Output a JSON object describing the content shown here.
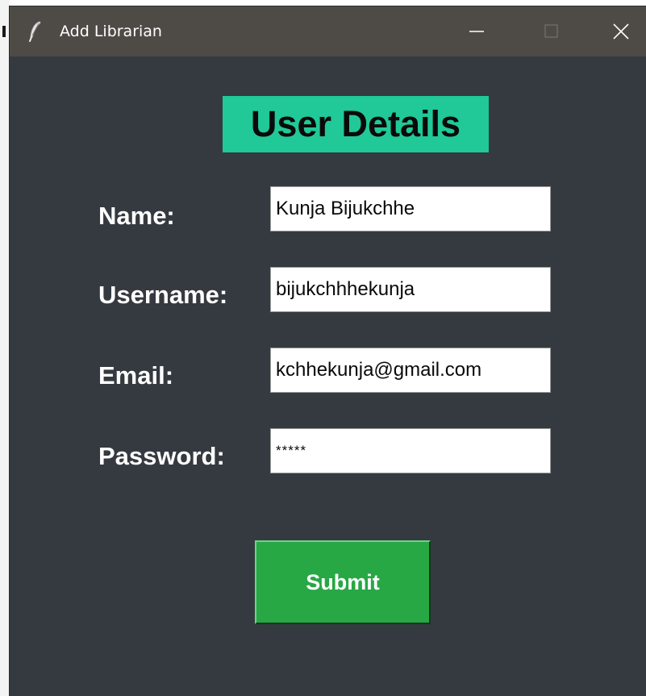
{
  "window": {
    "title": "Add Librarian"
  },
  "heading": "User Details",
  "fields": [
    {
      "label": "Name:",
      "value": "Kunja Bijukchhe"
    },
    {
      "label": "Username:",
      "value": "bijukchhhekunja"
    },
    {
      "label": "Email:",
      "value": "kchhekunja@gmail.com"
    },
    {
      "label": "Password:",
      "value": "*****"
    }
  ],
  "submit_label": "Submit",
  "colors": {
    "background": "#353a40",
    "titlebar": "#4e4b47",
    "heading_bg": "#20c997",
    "submit_bg": "#28a745"
  },
  "icons": {
    "app": "feather-icon",
    "minimize": "minimize-icon",
    "maximize": "maximize-icon",
    "close": "close-icon"
  }
}
